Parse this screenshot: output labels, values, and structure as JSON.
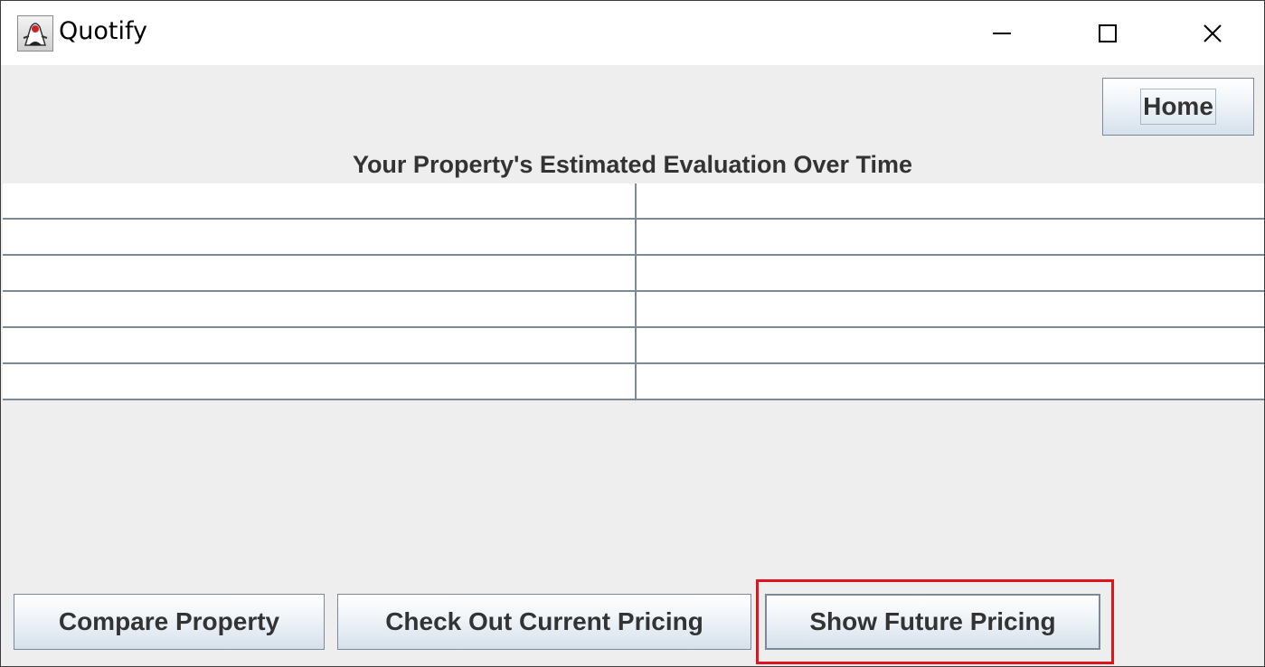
{
  "window": {
    "title": "Quotify",
    "icon": "java-duke-icon",
    "controls": [
      "minimize-icon",
      "maximize-icon",
      "close-icon"
    ]
  },
  "header": {
    "home_label": "Home"
  },
  "main": {
    "heading": "Your Property's Estimated Evaluation Over Time",
    "table": {
      "columns": 2,
      "rows": [
        [
          "",
          ""
        ],
        [
          "",
          ""
        ],
        [
          "",
          ""
        ],
        [
          "",
          ""
        ],
        [
          "",
          ""
        ],
        [
          "",
          ""
        ]
      ]
    }
  },
  "footer": {
    "buttons": [
      "Compare Property",
      "Check Out Current Pricing",
      "Show Future Pricing"
    ],
    "highlighted": "Show Future Pricing"
  },
  "colors": {
    "highlight": "#e0141e",
    "panel_bg": "#eeeeee",
    "button_text": "#333333",
    "grid_line": "#7a8a99"
  }
}
